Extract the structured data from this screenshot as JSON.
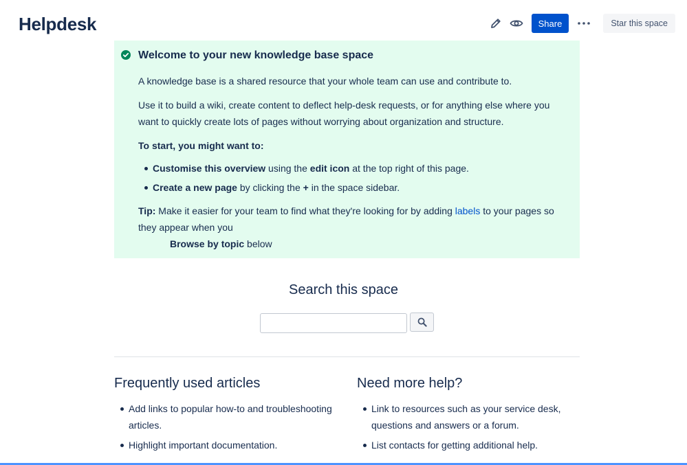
{
  "header": {
    "title": "Helpdesk",
    "share_label": "Share",
    "more_label": "•••",
    "star_label": "Star this space",
    "icons": {
      "edit": "pencil-icon",
      "watch": "eye-icon",
      "more": "more-icon"
    },
    "accent_color": "#0052cc"
  },
  "panel": {
    "background": "#e3fcef",
    "icon": "check-circle-icon",
    "title": "Welcome to your new knowledge base space",
    "p1": "A knowledge base is a shared resource that your whole team can use and contribute to.",
    "p2": "Use it to build a wiki, create content to deflect help-desk requests, or for anything else where you want to quickly create lots of pages without worrying about organization and structure.",
    "start_heading": "To start, you might want to:",
    "items": [
      {
        "bold": "Customise this overview",
        "t1": " using the ",
        "bold2": "edit icon",
        "t2": " at the top right of this page."
      },
      {
        "bold": "Create a new page",
        "t1": " by clicking the ",
        "bold2": "+",
        "t2": " in the space sidebar."
      }
    ],
    "tip_label": "Tip:",
    "tip_text": " Make it easier for your team to find what they're looking for by adding ",
    "tip_link": "labels",
    "tip_text2": " to your pages so they appear when you",
    "tip_bold": "Browse by topic",
    "tip_after": " below"
  },
  "search": {
    "heading": "Search this space",
    "value": "",
    "icon": "search-icon"
  },
  "left_column": {
    "heading": "Frequently used articles",
    "items": [
      "Add links to popular how-to and troubleshooting articles.",
      "Highlight important documentation."
    ]
  },
  "right_column": {
    "heading": "Need more help?",
    "items": [
      "Link to resources such as your service desk, questions and answers or a forum.",
      "List contacts for getting additional help."
    ]
  }
}
